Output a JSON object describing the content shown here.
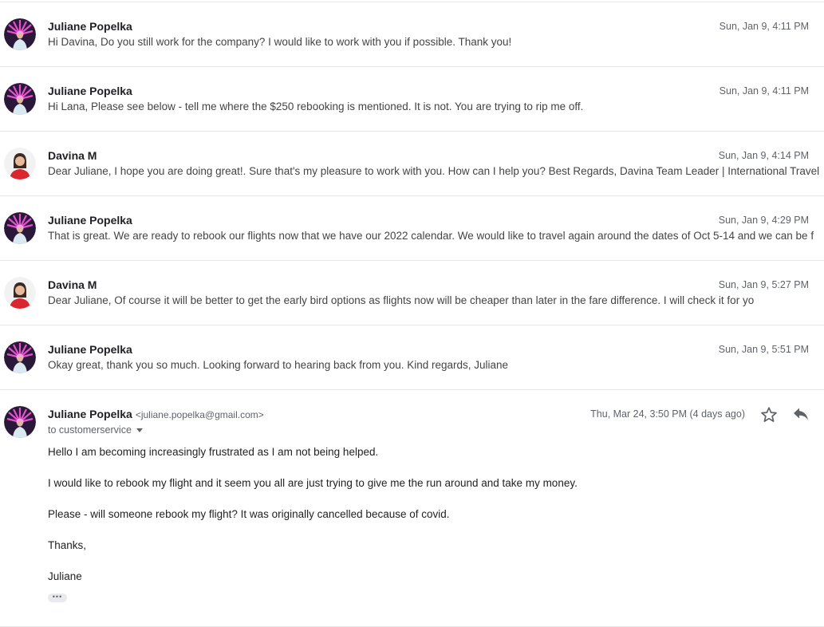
{
  "messages": [
    {
      "sender": "Juliane Popelka",
      "date": "Sun, Jan 9, 4:11 PM",
      "snippet": "Hi Davina, Do you still work for the company? I would like to work with you if possible. Thank you!",
      "avatar": "juliane-avatar"
    },
    {
      "sender": "Juliane Popelka",
      "date": "Sun, Jan 9, 4:11 PM",
      "snippet": "Hi Lana, Please see below - tell me where the $250 rebooking is mentioned. It is not. You are trying to rip me off.",
      "avatar": "juliane-avatar"
    },
    {
      "sender": "Davina M",
      "date": "Sun, Jan 9, 4:14 PM",
      "snippet": "Dear Juliane, I hope you are doing great!. Sure that's my pleasure to work with you. How can I help you? Best Regards, Davina Team Leader | International Travel",
      "avatar": "davina-avatar"
    },
    {
      "sender": "Juliane Popelka",
      "date": "Sun, Jan 9, 4:29 PM",
      "snippet": "That is great. We are ready to rebook our flights now that we have our 2022 calendar. We would like to travel again around the dates of Oct 5-14 and we can be f",
      "avatar": "juliane-avatar"
    },
    {
      "sender": "Davina M",
      "date": "Sun, Jan 9, 5:27 PM",
      "snippet": "Dear Juliane, Of course it will be better to get the early bird options as flights now will be cheaper than later in the fare difference. I will check it for yo",
      "avatar": "davina-avatar"
    },
    {
      "sender": "Juliane Popelka",
      "date": "Sun, Jan 9, 5:51 PM",
      "snippet": "Okay great, thank you so much. Looking forward to hearing back from you. Kind regards, Juliane",
      "avatar": "juliane-avatar"
    }
  ],
  "expanded": {
    "sender": "Juliane Popelka",
    "email": "<juliane.popelka@gmail.com>",
    "to": "to customerservice",
    "date": "Thu, Mar 24, 3:50 PM (4 days ago)",
    "body": [
      "Hello I am becoming increasingly frustrated as I am not being helped.",
      "I would like to rebook my flight and it seem you all are just trying to give me the run around and take my money.",
      "Please - will someone rebook my flight?  It was originally cancelled because of covid.",
      "Thanks,",
      "Juliane"
    ],
    "more_label": "•••",
    "icons": {
      "star": "star-icon",
      "reply": "reply-icon",
      "caret": "chevron-down-icon"
    }
  },
  "colors": {
    "sender_text": "#202124",
    "meta_text": "#5f6368",
    "snippet_text": "#444444",
    "divider": "#e6e6e6",
    "juliane_avatar_accent": "#d63fbf",
    "davina_avatar_accent": "#d9262f"
  }
}
